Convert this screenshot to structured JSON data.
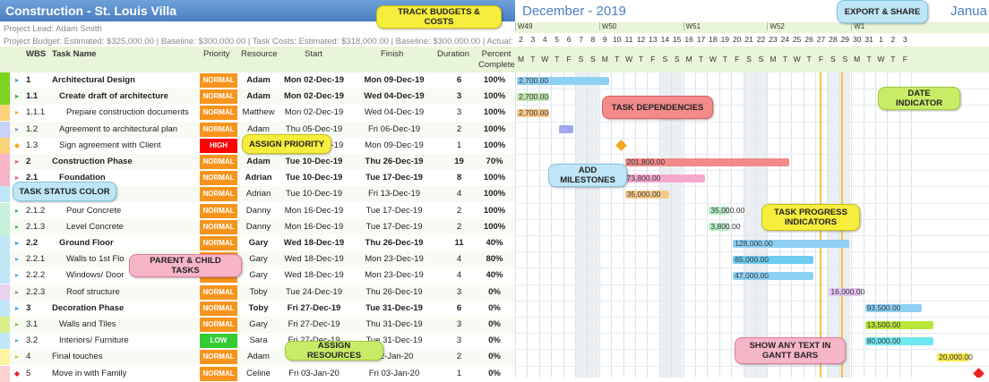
{
  "project": {
    "title": "Construction - St. Louis Villa",
    "lead_line": "Project Lead: Adam Smith",
    "budget_line": "Project Budget: Estimated: $325,000.00 | Baseline: $300,000.00 | Task Costs: Estimated: $318,000.00 | Baseline: $300,000.00 | Actual:"
  },
  "columns": {
    "wbs": "WBS",
    "task": "Task Name",
    "priority": "Priority",
    "resource": "Resource",
    "start": "Start",
    "finish": "Finish",
    "duration": "Duration",
    "percent": "Percent Complete"
  },
  "colors": {
    "normal": "#f7941d",
    "high": "#ff0000",
    "low": "#33cc33",
    "header_green": "#e8f5d8",
    "title_blue": "#4a7fc4"
  },
  "tasks": [
    {
      "wbs": "1",
      "name": "Architectural Design",
      "prio": "NORMAL",
      "res": "Adam",
      "start": "Mon 02-Dec-19",
      "finish": "Mon 09-Dec-19",
      "dur": "6",
      "pct": "100%",
      "bold": true,
      "indent": 0,
      "stripe": "#7ed321",
      "tri": "#4fa8e0"
    },
    {
      "wbs": "1.1",
      "name": "Create draft of architecture",
      "prio": "NORMAL",
      "res": "Adam",
      "start": "Mon 02-Dec-19",
      "finish": "Wed 04-Dec-19",
      "dur": "3",
      "pct": "100%",
      "bold": true,
      "indent": 1,
      "stripe": "#7ed321",
      "tri": "#3fb54a"
    },
    {
      "wbs": "1.1.1",
      "name": "Prepare construction documents",
      "prio": "NORMAL",
      "res": "Matthew",
      "start": "Mon 02-Dec-19",
      "finish": "Wed 04-Dec-19",
      "dur": "3",
      "pct": "100%",
      "bold": false,
      "indent": 2,
      "stripe": "#f9d27a",
      "tri": "#f5a623"
    },
    {
      "wbs": "1.2",
      "name": "Agreement to architectural plan",
      "prio": "NORMAL",
      "res": "Adam",
      "start": "Thu 05-Dec-19",
      "finish": "Fri 06-Dec-19",
      "dur": "2",
      "pct": "100%",
      "bold": false,
      "indent": 1,
      "stripe": "#c7d3f7",
      "tri": "#7f8fe0"
    },
    {
      "wbs": "1.3",
      "name": "Sign agreement with Client",
      "prio": "HIGH",
      "res": "",
      "start": "Mon 09-Dec-19",
      "finish": "Mon 09-Dec-19",
      "dur": "1",
      "pct": "100%",
      "bold": false,
      "indent": 1,
      "stripe": "#f9d27a",
      "tri": "#f5a623"
    },
    {
      "wbs": "2",
      "name": "Construction Phase",
      "prio": "NORMAL",
      "res": "Adam",
      "start": "Tue 10-Dec-19",
      "finish": "Thu 26-Dec-19",
      "dur": "19",
      "pct": "70%",
      "bold": true,
      "indent": 0,
      "stripe": "#f7b5c8",
      "tri": "#e06a8f"
    },
    {
      "wbs": "2.1",
      "name": "Foundation",
      "prio": "NORMAL",
      "res": "Adrian",
      "start": "Tue 10-Dec-19",
      "finish": "Tue 17-Dec-19",
      "dur": "8",
      "pct": "100%",
      "bold": true,
      "indent": 1,
      "stripe": "#f7b5c8",
      "tri": "#e06a8f"
    },
    {
      "wbs": "",
      "name": "",
      "prio": "NORMAL",
      "res": "Adrian",
      "start": "Tue 10-Dec-19",
      "finish": "Fri 13-Dec-19",
      "dur": "4",
      "pct": "100%",
      "bold": false,
      "indent": 2,
      "stripe": "#bfe6f7",
      "tri": "#4fa8e0"
    },
    {
      "wbs": "2.1.2",
      "name": "Pour Concrete",
      "prio": "NORMAL",
      "res": "Danny",
      "start": "Mon 16-Dec-19",
      "finish": "Tue 17-Dec-19",
      "dur": "2",
      "pct": "100%",
      "bold": false,
      "indent": 2,
      "stripe": "#c8f0d8",
      "tri": "#3fb54a"
    },
    {
      "wbs": "2.1.3",
      "name": "Level Concrete",
      "prio": "NORMAL",
      "res": "Danny",
      "start": "Mon 16-Dec-19",
      "finish": "Tue 17-Dec-19",
      "dur": "2",
      "pct": "100%",
      "bold": false,
      "indent": 2,
      "stripe": "#c8f0d8",
      "tri": "#3fb54a"
    },
    {
      "wbs": "2.2",
      "name": "Ground Floor",
      "prio": "NORMAL",
      "res": "Gary",
      "start": "Wed 18-Dec-19",
      "finish": "Thu 26-Dec-19",
      "dur": "11",
      "pct": "40%",
      "bold": true,
      "indent": 1,
      "stripe": "#bfe6f7",
      "tri": "#4fa8e0"
    },
    {
      "wbs": "2.2.1",
      "name": "Walls to 1st Flo",
      "prio": "NORMAL",
      "res": "Gary",
      "start": "Wed 18-Dec-19",
      "finish": "Mon 23-Dec-19",
      "dur": "4",
      "pct": "80%",
      "bold": false,
      "indent": 2,
      "stripe": "#bfe6f7",
      "tri": "#4fa8e0"
    },
    {
      "wbs": "2.2.2",
      "name": "Windows/ Door",
      "prio": "NORMAL",
      "res": "Gary",
      "start": "Wed 18-Dec-19",
      "finish": "Mon 23-Dec-19",
      "dur": "4",
      "pct": "40%",
      "bold": false,
      "indent": 2,
      "stripe": "#bfe6f7",
      "tri": "#4fa8e0"
    },
    {
      "wbs": "2.2.3",
      "name": "Roof structure",
      "prio": "NORMAL",
      "res": "Toby",
      "start": "Tue 24-Dec-19",
      "finish": "Thu 26-Dec-19",
      "dur": "3",
      "pct": "0%",
      "bold": false,
      "indent": 2,
      "stripe": "#e7d3f0",
      "tri": "#b07cc6"
    },
    {
      "wbs": "3",
      "name": "Decoration Phase",
      "prio": "NORMAL",
      "res": "Toby",
      "start": "Fri 27-Dec-19",
      "finish": "Tue 31-Dec-19",
      "dur": "6",
      "pct": "0%",
      "bold": true,
      "indent": 0,
      "stripe": "#bfe6f7",
      "tri": "#4fa8e0"
    },
    {
      "wbs": "3.1",
      "name": "Walls and Tiles",
      "prio": "NORMAL",
      "res": "Gary",
      "start": "Fri 27-Dec-19",
      "finish": "Thu 31-Dec-19",
      "dur": "3",
      "pct": "0%",
      "bold": false,
      "indent": 1,
      "stripe": "#d8f08a",
      "tri": "#8bc34a"
    },
    {
      "wbs": "3.2",
      "name": "Interiors/ Furniture",
      "prio": "LOW",
      "res": "Sara",
      "start": "Fri 27-Dec-19",
      "finish": "Tue 31-Dec-19",
      "dur": "3",
      "pct": "0%",
      "bold": false,
      "indent": 1,
      "stripe": "#bfe6f7",
      "tri": "#4fa8e0"
    },
    {
      "wbs": "4",
      "name": "Final touches",
      "prio": "NORMAL",
      "res": "Adam",
      "start": "",
      "finish": "02-Jan-20",
      "dur": "2",
      "pct": "0%",
      "bold": false,
      "indent": 0,
      "stripe": "#fff5a0",
      "tri": "#e0c020"
    },
    {
      "wbs": "5",
      "name": "Move in with Family",
      "prio": "NORMAL",
      "res": "Celine",
      "start": "Fri 03-Jan-20",
      "finish": "Fri 03-Jan-20",
      "dur": "1",
      "pct": "0%",
      "bold": false,
      "indent": 0,
      "stripe": "#ffd0d0",
      "tri": "#ee2222"
    }
  ],
  "gantt": {
    "month_dec": "December - 2019",
    "month_jan": "Janua",
    "weeks": [
      "W49",
      "W50",
      "W51",
      "W52",
      "W1"
    ],
    "days": [
      "2",
      "3",
      "4",
      "5",
      "6",
      "7",
      "8",
      "9",
      "10",
      "11",
      "12",
      "13",
      "14",
      "15",
      "16",
      "17",
      "18",
      "19",
      "20",
      "21",
      "22",
      "23",
      "24",
      "25",
      "26",
      "27",
      "28",
      "29",
      "30",
      "31",
      "1",
      "2",
      "3"
    ],
    "dow": [
      "M",
      "T",
      "W",
      "T",
      "F",
      "S",
      "S",
      "M",
      "T",
      "W",
      "T",
      "F",
      "S",
      "S",
      "M",
      "T",
      "W",
      "T",
      "F",
      "S",
      "S",
      "M",
      "T",
      "W",
      "T",
      "F",
      "S",
      "S",
      "M",
      "T",
      "W",
      "T",
      "F"
    ],
    "bar_labels": [
      "2,700.00",
      "2,700.00",
      "2,700.00",
      "",
      "",
      "201,800.00",
      "73,800.00",
      "35,000.00",
      "35,000.00",
      "3,800.00",
      "128,000.00",
      "65,000.00",
      "47,000.00",
      "16,000.00",
      "93,500.00",
      "13,500.00",
      "80,000.00",
      "20,000.00",
      ""
    ]
  },
  "callouts": {
    "budgets": "TRACK BUDGETS & COSTS",
    "export": "EXPORT & SHARE",
    "dependencies": "TASK DEPENDENCIES",
    "date": "DATE INDICATOR",
    "priority": "ASSIGN PRIORITY",
    "milestones": "ADD MILESTONES",
    "status": "TASK STATUS COLOR",
    "progress": "TASK PROGRESS INDICATORS",
    "parent": "PARENT & CHILD TASKS",
    "resources": "ASSIGN RESOURCES",
    "text": "SHOW ANY TEXT IN GANTT BARS"
  }
}
